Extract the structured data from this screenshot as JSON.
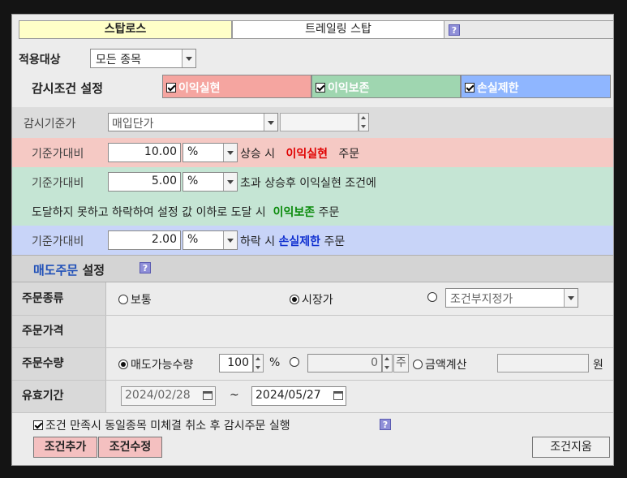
{
  "tabs": [
    {
      "label": "스탑로스",
      "active": true
    },
    {
      "label": "트레일링 스탑",
      "active": false
    }
  ],
  "help_glyph": "?",
  "target": {
    "label": "적용대상",
    "value": "모든 종목"
  },
  "monitor": {
    "title": "감시조건 설정",
    "profit_take": "이익실현",
    "profit_keep": "이익보존",
    "stop_loss": "손실제한"
  },
  "base_price": {
    "label": "감시기준가",
    "value": "매입단가"
  },
  "rows": {
    "profit": {
      "label": "기준가대비",
      "value": "10.00",
      "unit": "%",
      "text": "상승 시",
      "keyword": "이익실현",
      "suffix": "주문"
    },
    "preserve": {
      "label": "기준가대비",
      "value": "5.00",
      "unit": "%",
      "text": "초과 상승후 이익실현 조건에",
      "line2": "도달하지 못하고 하락하여 설정 값 이하로 도달 시",
      "keyword": "이익보존",
      "suffix": "주문"
    },
    "loss": {
      "label": "기준가대비",
      "value": "2.00",
      "unit": "%",
      "text": "하락 시",
      "keyword": "손실제한",
      "suffix": "주문"
    }
  },
  "sell": {
    "title_colored": "매도주문",
    "title_rest": "설정"
  },
  "order_type": {
    "label": "주문종류",
    "opt1": "보통",
    "opt2": "시장가",
    "opt3": "조건부지정가"
  },
  "order_price": {
    "label": "주문가격"
  },
  "order_qty": {
    "label": "주문수량",
    "opt1": "매도가능수량",
    "opt1_value": "100",
    "opt1_unit": "%",
    "opt2_value": "0",
    "opt2_unit": "주",
    "opt3": "금액계산",
    "currency": "원"
  },
  "validity": {
    "label": "유효기간",
    "from": "2024/02/28",
    "sep": "~",
    "to": "2024/05/27"
  },
  "footer": {
    "checkbox_label": "조건 만족시 동일종목 미체결 취소 후 감시주문 실행",
    "add": "조건추가",
    "edit": "조건수정",
    "delete": "조건지움"
  },
  "colors": {
    "tab_active": "#ffffc8",
    "profit_bg": "#f5c9c4",
    "preserve_bg": "#c5e5d4",
    "loss_bg": "#c8d4f8",
    "profit_text": "#e00000",
    "preserve_text": "#0a8a0a",
    "loss_text": "#1030d0",
    "sell_title": "#1f4fb8"
  }
}
